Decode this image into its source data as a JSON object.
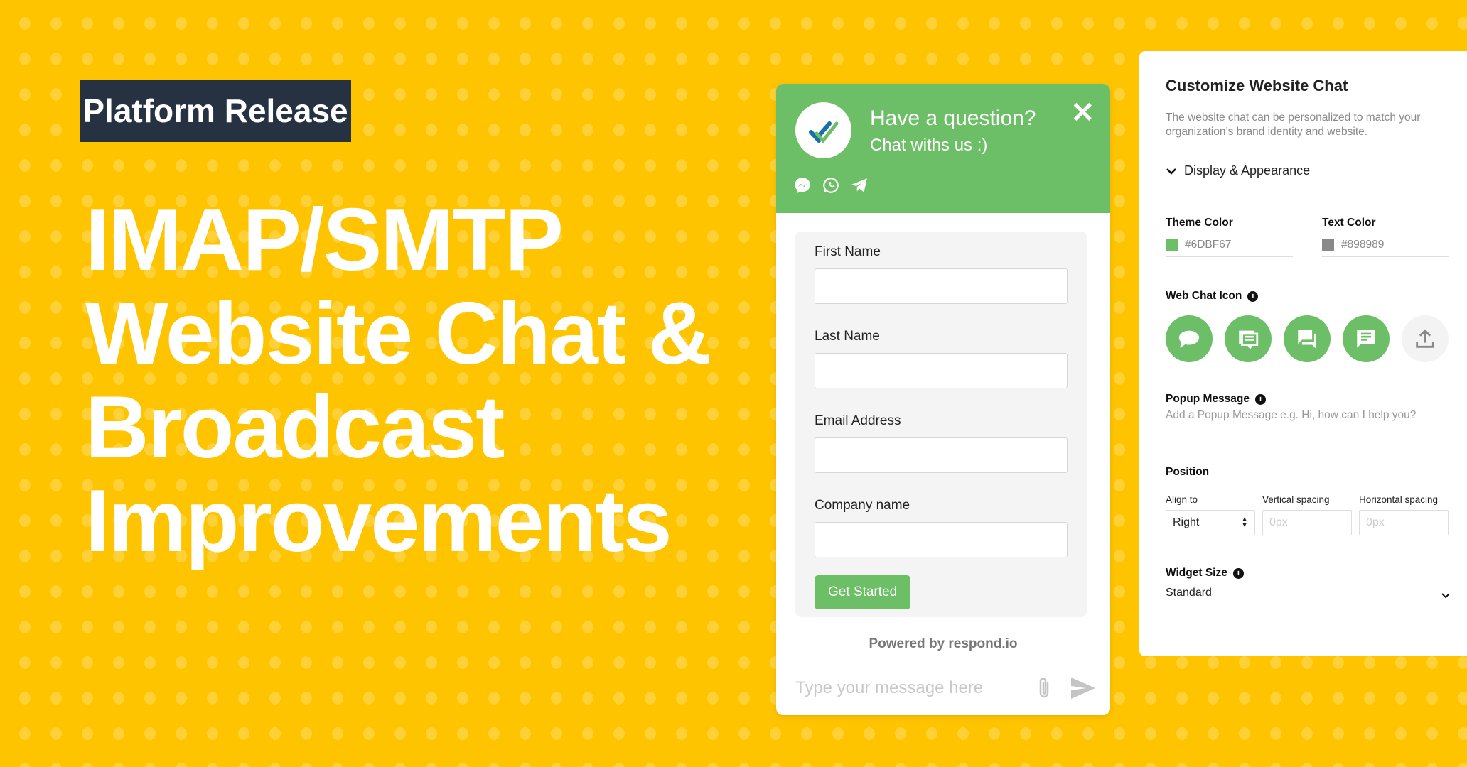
{
  "badge": "Platform Release",
  "headline": [
    "IMAP/SMTP",
    "Website Chat &",
    "Broadcast",
    "Improvements"
  ],
  "colors": {
    "background": "#FFC400",
    "badge": "#263241",
    "theme": "#6DBF67",
    "text": "#898989"
  },
  "chat": {
    "title": "Have a question?",
    "subtitle": "Chat withs us :)",
    "close_icon": "close-icon",
    "channels": [
      "messenger-icon",
      "whatsapp-icon",
      "telegram-icon"
    ],
    "fields": [
      {
        "label": "First Name",
        "value": ""
      },
      {
        "label": "Last Name",
        "value": ""
      },
      {
        "label": "Email Address",
        "value": ""
      },
      {
        "label": "Company name",
        "value": ""
      }
    ],
    "submit": "Get Started",
    "powered": "Powered by respond.io",
    "composer_placeholder": "Type your message here"
  },
  "panel": {
    "title": "Customize Website Chat",
    "description": "The website chat can be personalized to match your organization’s brand identity and website.",
    "section": "Display & Appearance",
    "theme_color_label": "Theme Color",
    "theme_color": "#6DBF67",
    "text_color_label": "Text Color",
    "text_color": "#898989",
    "web_chat_icon_label": "Web Chat Icon",
    "icon_options": [
      "speech-bubble-icon",
      "forum-lines-icon",
      "forum-icon",
      "message-lines-icon",
      "upload-icon"
    ],
    "popup_label": "Popup Message",
    "popup_placeholder": "Add a Popup Message e.g. Hi, how can I help you?",
    "position_label": "Position",
    "align_label": "Align to",
    "align_value": "Right",
    "vertical_label": "Vertical spacing",
    "vertical_placeholder": "0px",
    "horizontal_label": "Horizontal spacing",
    "horizontal_placeholder": "0px",
    "widget_size_label": "Widget Size",
    "widget_size_value": "Standard"
  }
}
